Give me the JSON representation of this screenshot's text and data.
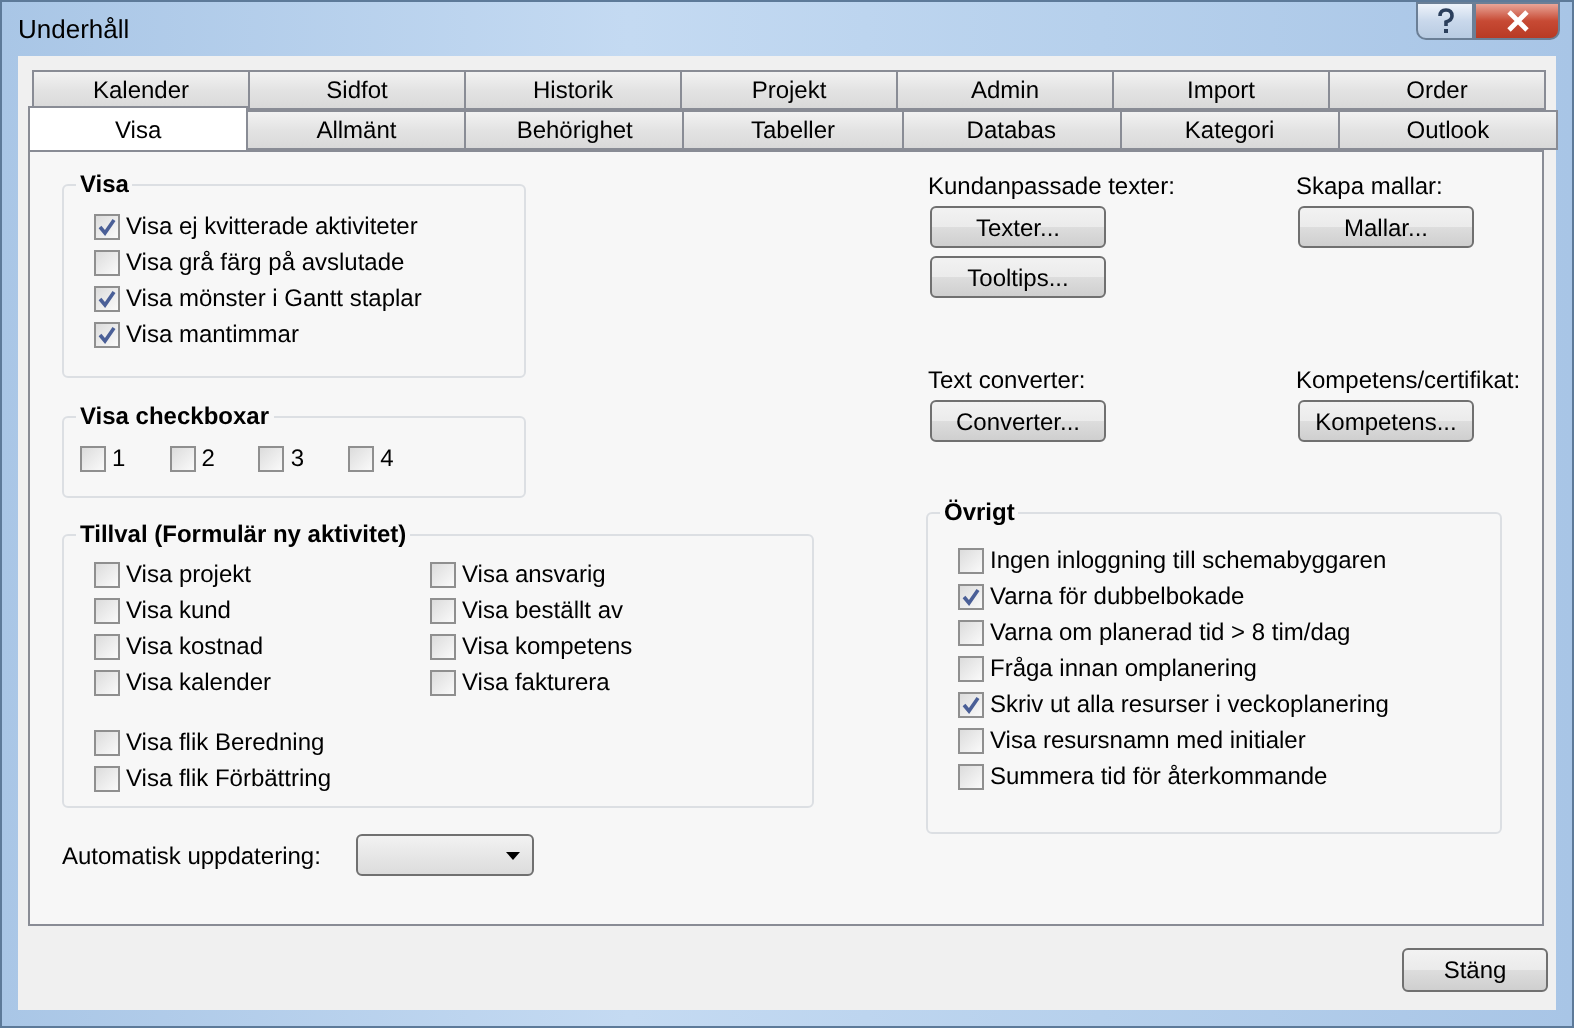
{
  "window": {
    "title": "Underhåll"
  },
  "tab_rows": [
    {
      "tabs": [
        {
          "label": "Kalender",
          "selected": false
        },
        {
          "label": "Sidfot",
          "selected": false
        },
        {
          "label": "Historik",
          "selected": false
        },
        {
          "label": "Projekt",
          "selected": false
        },
        {
          "label": "Admin",
          "selected": false
        },
        {
          "label": "Import",
          "selected": false
        },
        {
          "label": "Order",
          "selected": false
        }
      ]
    },
    {
      "tabs": [
        {
          "label": "Visa",
          "selected": true
        },
        {
          "label": "Allmänt",
          "selected": false
        },
        {
          "label": "Behörighet",
          "selected": false
        },
        {
          "label": "Tabeller",
          "selected": false
        },
        {
          "label": "Databas",
          "selected": false
        },
        {
          "label": "Kategori",
          "selected": false
        },
        {
          "label": "Outlook",
          "selected": false
        }
      ]
    }
  ],
  "visa": {
    "title": "Visa",
    "options": [
      {
        "label": "Visa ej kvitterade aktiviteter",
        "checked": true
      },
      {
        "label": "Visa grå färg på avslutade",
        "checked": false
      },
      {
        "label": "Visa mönster i Gantt staplar",
        "checked": true
      },
      {
        "label": "Visa mantimmar",
        "checked": true
      }
    ]
  },
  "visa_checkboxar": {
    "title": "Visa checkboxar",
    "options": [
      {
        "label": "1",
        "checked": false
      },
      {
        "label": "2",
        "checked": false
      },
      {
        "label": "3",
        "checked": false
      },
      {
        "label": "4",
        "checked": false
      }
    ]
  },
  "tillval": {
    "title": "Tillval (Formulär ny aktivitet)",
    "column_1": [
      {
        "label": "Visa projekt",
        "checked": false
      },
      {
        "label": "Visa kund",
        "checked": false
      },
      {
        "label": "Visa kostnad",
        "checked": false
      },
      {
        "label": "Visa kalender",
        "checked": false
      }
    ],
    "column_2": [
      {
        "label": "Visa ansvarig",
        "checked": false
      },
      {
        "label": "Visa beställt av",
        "checked": false
      },
      {
        "label": "Visa kompetens",
        "checked": false
      },
      {
        "label": "Visa fakturera",
        "checked": false
      }
    ],
    "extra": [
      {
        "label": "Visa flik Beredning",
        "checked": false
      },
      {
        "label": "Visa flik Förbättring",
        "checked": false
      }
    ]
  },
  "automatisk_uppdatering": {
    "label": "Automatisk uppdatering:"
  },
  "button_groups": [
    {
      "label": "Kundanpassade texter:",
      "buttons": [
        "Texter...",
        "Tooltips..."
      ]
    },
    {
      "label": "Skapa mallar:",
      "buttons": [
        "Mallar..."
      ]
    },
    {
      "label": "Text converter:",
      "buttons": [
        "Converter..."
      ]
    },
    {
      "label": "Kompetens/certifikat:",
      "buttons": [
        "Kompetens..."
      ]
    }
  ],
  "ovrigt": {
    "title": "Övrigt",
    "options": [
      {
        "label": "Ingen inloggning till schemabyggaren",
        "checked": false
      },
      {
        "label": "Varna för dubbelbokade",
        "checked": true
      },
      {
        "label": "Varna om planerad tid > 8 tim/dag",
        "checked": false
      },
      {
        "label": "Fråga innan omplanering",
        "checked": false
      },
      {
        "label": "Skriv ut alla resurser i veckoplanering",
        "checked": true
      },
      {
        "label": "Visa resursnamn med initialer",
        "checked": false
      },
      {
        "label": "Summera tid för återkommande",
        "checked": false
      }
    ]
  },
  "close_button": "Stäng"
}
